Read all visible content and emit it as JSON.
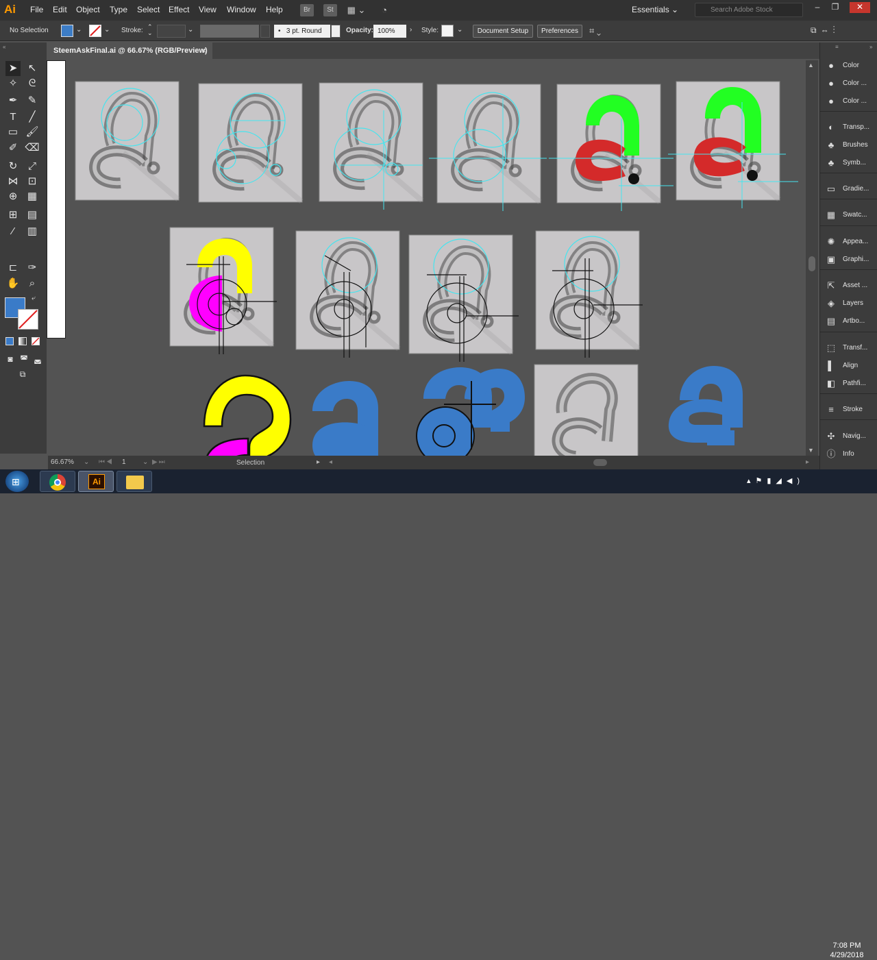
{
  "app": {
    "logo": "Ai",
    "menus": [
      "File",
      "Edit",
      "Object",
      "Type",
      "Select",
      "Effect",
      "View",
      "Window",
      "Help"
    ],
    "bridge_label": "Br",
    "stock_label": "St",
    "workspace": "Essentials",
    "search_placeholder": "Search Adobe Stock"
  },
  "control_bar": {
    "selection_state": "No Selection",
    "fill_color": "#3d7dc6",
    "stroke_label": "Stroke:",
    "brush_value": "3 pt. Round",
    "opacity_label": "Opacity:",
    "opacity_value": "100%",
    "style_label": "Style:",
    "document_setup": "Document Setup",
    "preferences": "Preferences"
  },
  "document": {
    "tab_title": "SteemAskFinal.ai @ 66.67% (RGB/Preview)",
    "close_glyph": "×"
  },
  "status": {
    "zoom": "66.67%",
    "artboard_number": "1",
    "tool_name": "Selection"
  },
  "panels": [
    {
      "icon": "color-icon",
      "glyph": "●",
      "label": "Color"
    },
    {
      "icon": "color-guide-icon",
      "glyph": "●",
      "label": "Color ..."
    },
    {
      "icon": "color-themes-icon",
      "glyph": "●",
      "label": "Color ..."
    },
    {
      "icon": "transparency-icon",
      "glyph": "◐",
      "label": "Transp..."
    },
    {
      "icon": "brushes-icon",
      "glyph": "♣",
      "label": "Brushes"
    },
    {
      "icon": "symbols-icon",
      "glyph": "♣",
      "label": "Symb..."
    },
    {
      "icon": "gradient-icon",
      "glyph": "▭",
      "label": "Gradie..."
    },
    {
      "icon": "swatches-icon",
      "glyph": "▦",
      "label": "Swatc..."
    },
    {
      "icon": "appearance-icon",
      "glyph": "✺",
      "label": "Appea..."
    },
    {
      "icon": "graphic-styles-icon",
      "glyph": "▣",
      "label": "Graphi..."
    },
    {
      "icon": "asset-export-icon",
      "glyph": "⇱",
      "label": "Asset ..."
    },
    {
      "icon": "layers-icon",
      "glyph": "◈",
      "label": "Layers"
    },
    {
      "icon": "artboards-icon",
      "glyph": "▤",
      "label": "Artbo..."
    },
    {
      "icon": "transform-icon",
      "glyph": "⬚",
      "label": "Transf..."
    },
    {
      "icon": "align-icon",
      "glyph": "▌",
      "label": "Align"
    },
    {
      "icon": "pathfinder-icon",
      "glyph": "◧",
      "label": "Pathfi..."
    },
    {
      "icon": "stroke-icon",
      "glyph": "≡",
      "label": "Stroke"
    },
    {
      "icon": "navigator-icon",
      "glyph": "✣",
      "label": "Navig..."
    },
    {
      "icon": "info-icon",
      "glyph": "ⓘ",
      "label": "Info"
    }
  ],
  "colors": {
    "guide": "#44e5ef",
    "green": "#22ff22",
    "red": "#d42a2a",
    "yellow": "#ffff00",
    "magenta": "#ff00ff",
    "blue": "#3a7bc8"
  },
  "taskbar": {
    "time": "7:08 PM",
    "date": "4/29/2018"
  }
}
